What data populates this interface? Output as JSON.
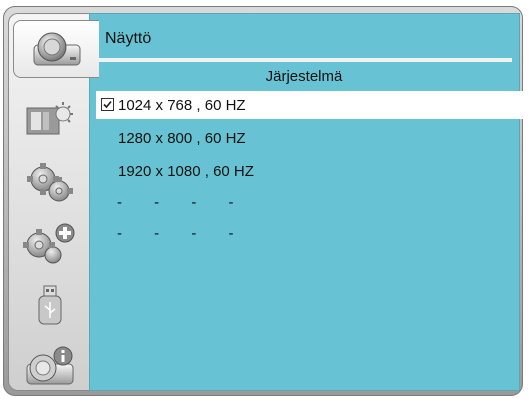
{
  "sidebar": {
    "items": [
      {
        "icon": "projector-icon",
        "active": true
      },
      {
        "icon": "picture-brightness-icon"
      },
      {
        "icon": "settings-gear-icon"
      },
      {
        "icon": "advanced-settings-icon"
      },
      {
        "icon": "usb-icon"
      },
      {
        "icon": "projector-info-icon"
      }
    ]
  },
  "header": {
    "title": "Näyttö",
    "subtitle": "Järjestelmä"
  },
  "menu": {
    "items": [
      {
        "label": "1024 x 768 , 60 HZ",
        "selected": true,
        "checked": true
      },
      {
        "label": "1280 x 800 , 60 HZ"
      },
      {
        "label": "1920 x 1080 , 60 HZ"
      },
      {
        "label": "- - - -"
      },
      {
        "label": "- - - -"
      }
    ]
  },
  "colors": {
    "panel": "#67c3d3",
    "selected_row": "#ffffff"
  }
}
